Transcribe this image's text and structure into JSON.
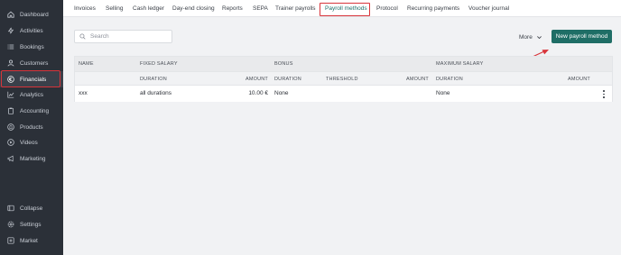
{
  "sidebar": {
    "items": [
      {
        "label": "Dashboard",
        "icon": "home-icon"
      },
      {
        "label": "Activities",
        "icon": "activity-icon"
      },
      {
        "label": "Bookings",
        "icon": "list-icon"
      },
      {
        "label": "Customers",
        "icon": "user-icon"
      },
      {
        "label": "Financials",
        "icon": "euro-icon",
        "active": true
      },
      {
        "label": "Analytics",
        "icon": "chart-icon"
      },
      {
        "label": "Accounting",
        "icon": "clipboard-icon"
      },
      {
        "label": "Products",
        "icon": "tag-icon"
      },
      {
        "label": "Videos",
        "icon": "play-icon"
      },
      {
        "label": "Marketing",
        "icon": "megaphone-icon"
      }
    ],
    "bottom": [
      {
        "label": "Collapse",
        "icon": "collapse-icon"
      },
      {
        "label": "Settings",
        "icon": "gear-icon"
      },
      {
        "label": "Market",
        "icon": "plus-square-icon"
      }
    ]
  },
  "tabs": [
    {
      "label": "Invoices"
    },
    {
      "label": "Selling"
    },
    {
      "label": "Cash ledger"
    },
    {
      "label": "Day-end closing"
    },
    {
      "label": "Reports"
    },
    {
      "label": "SEPA"
    },
    {
      "label": "Trainer payrolls"
    },
    {
      "label": "Payroll methods",
      "active": true
    },
    {
      "label": "Protocol"
    },
    {
      "label": "Recurring payments"
    },
    {
      "label": "Voucher journal"
    }
  ],
  "toolbar": {
    "search_placeholder": "Search",
    "more_label": "More",
    "new_button_label": "New payroll method"
  },
  "table": {
    "group_headers": {
      "name": "NAME",
      "fixed_salary": "FIXED SALARY",
      "bonus": "BONUS",
      "maximum_salary": "MAXIMUM SALARY"
    },
    "sub_headers": {
      "fixed_duration": "DURATION",
      "fixed_amount": "AMOUNT",
      "bonus_duration": "DURATION",
      "bonus_threshold": "THRESHOLD",
      "bonus_amount": "AMOUNT",
      "max_duration": "DURATION",
      "max_amount": "AMOUNT"
    },
    "rows": [
      {
        "name": "xxx",
        "fixed_duration": "all durations",
        "fixed_amount": "10.00 €",
        "bonus_duration": "None",
        "max_duration": "None"
      }
    ]
  },
  "colors": {
    "sidebar_bg": "#2b3038",
    "primary_button": "#1f6e66",
    "highlight_annotation": "#d8343a"
  }
}
